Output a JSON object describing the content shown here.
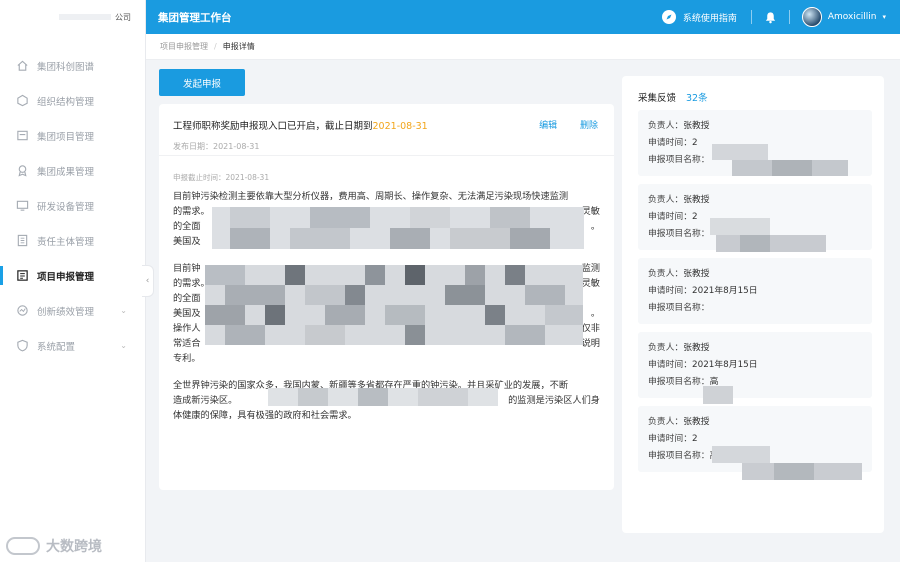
{
  "sidebar": {
    "brand_suffix": "公司",
    "items": [
      {
        "label": "集团科创图谱",
        "icon": "home-icon",
        "active": false,
        "expandable": false
      },
      {
        "label": "组织结构管理",
        "icon": "org-icon",
        "active": false,
        "expandable": false
      },
      {
        "label": "集团项目管理",
        "icon": "folder-icon",
        "active": false,
        "expandable": false
      },
      {
        "label": "集团成果管理",
        "icon": "award-icon",
        "active": false,
        "expandable": false
      },
      {
        "label": "研发设备管理",
        "icon": "device-icon",
        "active": false,
        "expandable": false
      },
      {
        "label": "责任主体管理",
        "icon": "building-icon",
        "active": false,
        "expandable": false
      },
      {
        "label": "项目申报管理",
        "icon": "form-icon",
        "active": true,
        "expandable": false
      },
      {
        "label": "创新绩效管理",
        "icon": "chart-icon",
        "active": false,
        "expandable": true
      },
      {
        "label": "系统配置",
        "icon": "shield-icon",
        "active": false,
        "expandable": true
      }
    ],
    "watermark": "大数跨境"
  },
  "header": {
    "title": "集团管理工作台",
    "guide_label": "系统使用指南",
    "username": "Amoxicillin"
  },
  "breadcrumb": {
    "parent": "项目申报管理",
    "separator": "/",
    "current": "申报详情"
  },
  "actions": {
    "primary_label": "发起申报"
  },
  "notice": {
    "title_prefix": "工程师职称奖励申报现入口已开启，截止日期到",
    "title_date": "2021-08-31",
    "publish_date": "发布日期：2021-08-31",
    "edit_label": "编辑",
    "delete_label": "删除",
    "deadline": "申报截止时间：2021-08-31",
    "para1_line1": "目前钟污染检测主要依靠大型分析仪器，费用高、周期长、操作复杂、无法满足污染现场快速监测",
    "para1_line2a": "的需求。",
    "para1_line2b": "灵敏",
    "para1_line3a": "的全面",
    "para1_line3b": "。",
    "para1_line4a": "美国及",
    "para2_line1a": "目前钟",
    "para2_line1b": "监测",
    "para2_line2a": "的需求。",
    "para2_line2b": "灵敏",
    "para2_line3a": "的全面",
    "para2_line4a": "美国及",
    "para2_line4b": "。",
    "para2_line5a": "操作人",
    "para2_line5b": "仅非",
    "para2_line6a": "常适合",
    "para2_line6b": "说明",
    "para2_line7": "专利。",
    "para3_line1": "全世界钟污染的国家众多，我国内蒙、新疆等多省都存在严重的钟污染。并且采矿业的发展，不断",
    "para3_line2a": "造成新污染区。",
    "para3_line2b": "的监测是污染区人们身",
    "para3_line3": "体健康的保障，具有极强的政府和社会需求。"
  },
  "feedback": {
    "title": "采集反馈",
    "count": "32条",
    "owner_label": "负责人：",
    "time_label": "申请时间：",
    "project_label": "申报项目名称：",
    "items": [
      {
        "owner": "张教授",
        "time": "2",
        "project": ""
      },
      {
        "owner": "张教授",
        "time": "2",
        "project": ""
      },
      {
        "owner": "张教授",
        "time": "2021年8月15日",
        "project": ""
      },
      {
        "owner": "张教授",
        "time": "2021年8月15日",
        "project": "高"
      },
      {
        "owner": "张教授",
        "time": "2",
        "project": "高"
      }
    ]
  }
}
